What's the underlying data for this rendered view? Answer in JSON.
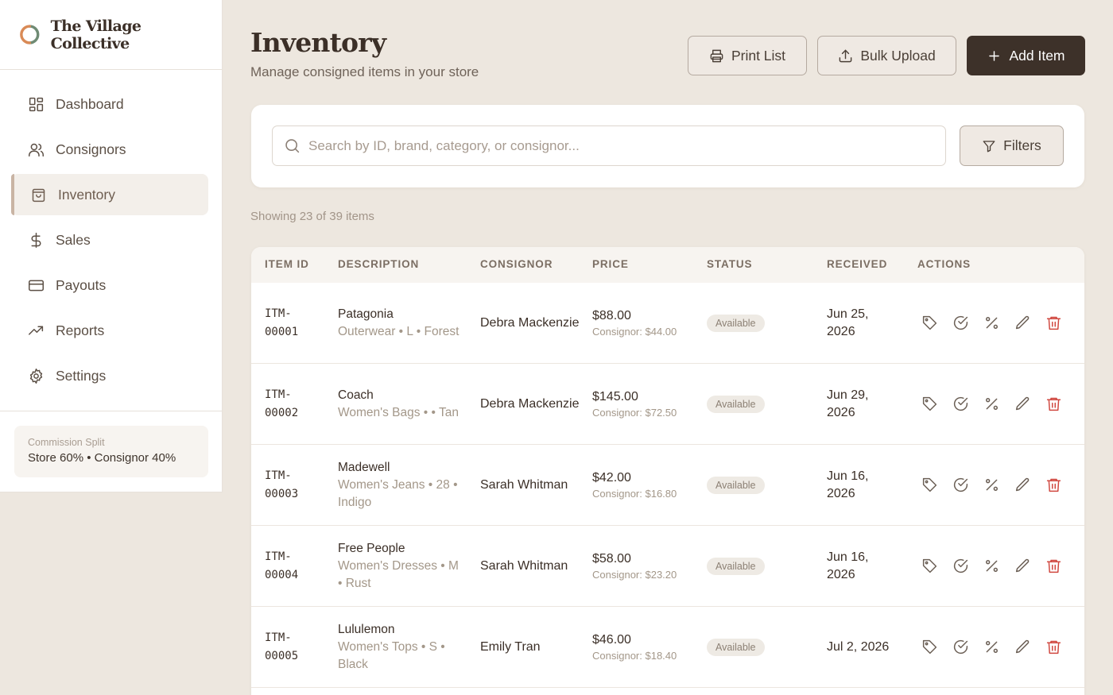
{
  "brand": {
    "name": "The Village Collective"
  },
  "nav": [
    {
      "label": "Dashboard",
      "icon": "dashboard-icon"
    },
    {
      "label": "Consignors",
      "icon": "users-icon"
    },
    {
      "label": "Inventory",
      "icon": "shopping-bag-icon",
      "active": true
    },
    {
      "label": "Sales",
      "icon": "dollar-icon"
    },
    {
      "label": "Payouts",
      "icon": "credit-card-icon"
    },
    {
      "label": "Reports",
      "icon": "trending-up-icon"
    },
    {
      "label": "Settings",
      "icon": "gear-icon"
    }
  ],
  "commission": {
    "label": "Commission Split",
    "value": "Store 60% • Consignor 40%"
  },
  "header": {
    "title": "Inventory",
    "subtitle": "Manage consigned items in your store",
    "print_label": "Print List",
    "bulk_label": "Bulk Upload",
    "add_label": "Add Item"
  },
  "search": {
    "placeholder": "Search by ID, brand, category, or consignor...",
    "value": "",
    "filters_label": "Filters"
  },
  "showing": "Showing 23 of 39 items",
  "table": {
    "columns": [
      "ITEM ID",
      "DESCRIPTION",
      "CONSIGNOR",
      "PRICE",
      "STATUS",
      "RECEIVED",
      "ACTIONS"
    ],
    "rows": [
      {
        "id": "ITM-\n00001",
        "brand": "Patagonia",
        "meta": "Outerwear • L • Forest",
        "consignor": "Debra Mackenzie",
        "price": "$88.00",
        "consignor_price": "Consignor: $44.00",
        "status": "Available",
        "received": "Jun 25, 2026"
      },
      {
        "id": "ITM-\n00002",
        "brand": "Coach",
        "meta": "Women's Bags • • Tan",
        "consignor": "Debra Mackenzie",
        "price": "$145.00",
        "consignor_price": "Consignor: $72.50",
        "status": "Available",
        "received": "Jun 29, 2026"
      },
      {
        "id": "ITM-\n00003",
        "brand": "Madewell",
        "meta": "Women's Jeans • 28 • Indigo",
        "consignor": "Sarah Whitman",
        "price": "$42.00",
        "consignor_price": "Consignor: $16.80",
        "status": "Available",
        "received": "Jun 16, 2026"
      },
      {
        "id": "ITM-\n00004",
        "brand": "Free People",
        "meta": "Women's Dresses • M • Rust",
        "consignor": "Sarah Whitman",
        "price": "$58.00",
        "consignor_price": "Consignor: $23.20",
        "status": "Available",
        "received": "Jun 16, 2026"
      },
      {
        "id": "ITM-\n00005",
        "brand": "Lululemon",
        "meta": "Women's Tops • S • Black",
        "consignor": "Emily Tran",
        "price": "$46.00",
        "consignor_price": "Consignor: $18.40",
        "status": "Available",
        "received": "Jul 2, 2026"
      }
    ]
  },
  "colors": {
    "primary": "#3d3129",
    "accent": "#c9b4a4",
    "delete": "#d0473f",
    "logo_orange": "#d98a56",
    "logo_green": "#6f8b74"
  }
}
